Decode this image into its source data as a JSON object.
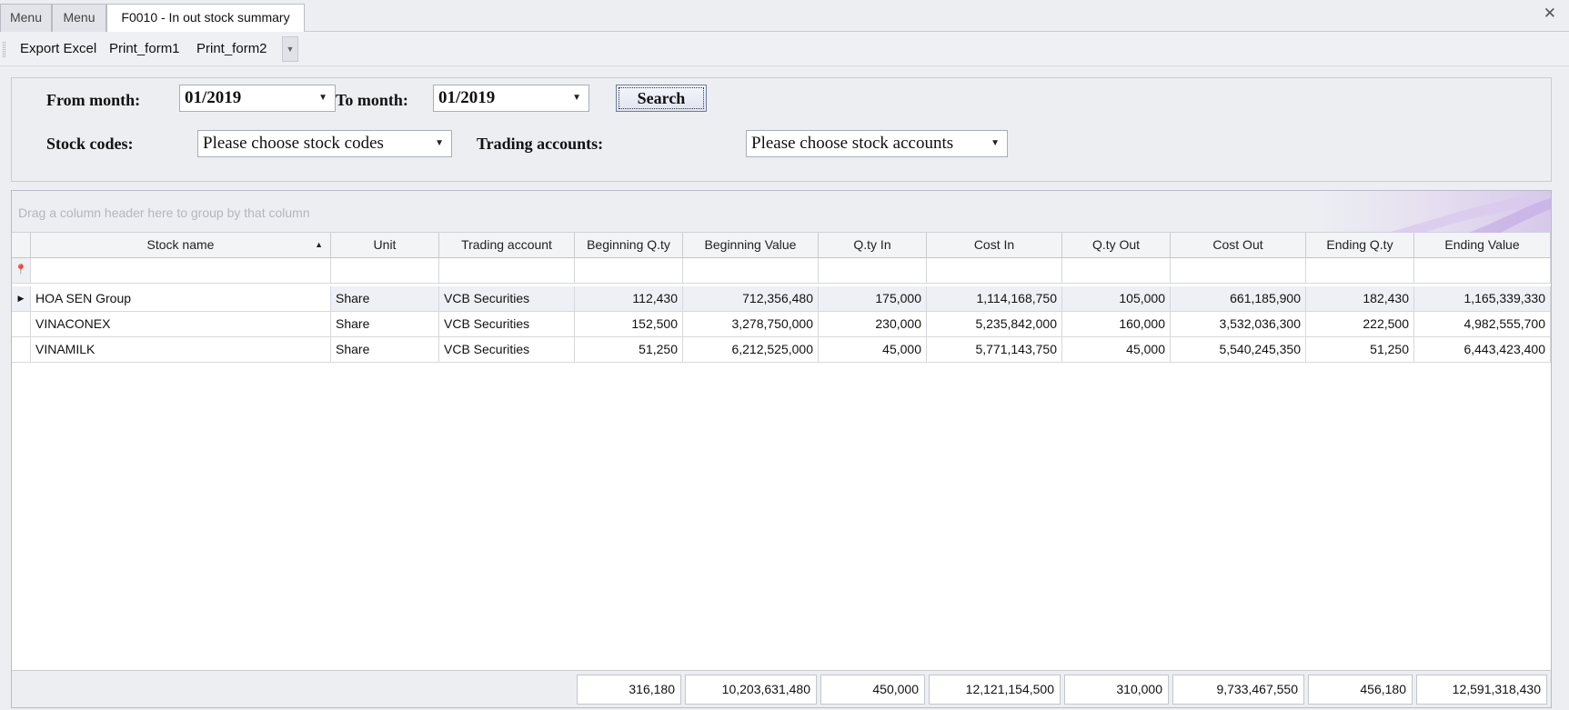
{
  "tabs": [
    {
      "label": "Menu"
    },
    {
      "label": "Menu"
    },
    {
      "label": "F0010 - In out stock summary"
    }
  ],
  "toolbar": {
    "export_excel": "Export Excel",
    "print_form1": "Print_form1",
    "print_form2": "Print_form2"
  },
  "filters": {
    "from_month_label": "From month:",
    "from_month_value": "01/2019",
    "to_month_label": "To month:",
    "to_month_value": "01/2019",
    "search_label": "Search",
    "stock_codes_label": "Stock codes:",
    "stock_codes_placeholder": "Please choose stock codes",
    "trading_accounts_label": "Trading accounts:",
    "trading_accounts_placeholder": "Please choose stock accounts"
  },
  "grid": {
    "group_hint": "Drag a column header here to group by that column",
    "columns": [
      "Stock name",
      "Unit",
      "Trading account",
      "Beginning Q.ty",
      "Beginning Value",
      "Q.ty In",
      "Cost In",
      "Q.ty Out",
      "Cost Out",
      "Ending Q.ty",
      "Ending Value"
    ],
    "rows": [
      [
        "HOA SEN Group",
        "Share",
        "VCB Securities",
        "112,430",
        "712,356,480",
        "175,000",
        "1,114,168,750",
        "105,000",
        "661,185,900",
        "182,430",
        "1,165,339,330"
      ],
      [
        "VINACONEX",
        "Share",
        "VCB Securities",
        "152,500",
        "3,278,750,000",
        "230,000",
        "5,235,842,000",
        "160,000",
        "3,532,036,300",
        "222,500",
        "4,982,555,700"
      ],
      [
        "VINAMILK",
        "Share",
        "VCB Securities",
        "51,250",
        "6,212,525,000",
        "45,000",
        "5,771,143,750",
        "45,000",
        "5,540,245,350",
        "51,250",
        "6,443,423,400"
      ]
    ],
    "totals": [
      "316,180",
      "10,203,631,480",
      "450,000",
      "12,121,154,500",
      "310,000",
      "9,733,467,550",
      "456,180",
      "12,591,318,430"
    ]
  },
  "colors": {
    "panel_bg": "#eceef1",
    "grid_border": "#b8bcc5",
    "search_border": "#6c7aa3"
  }
}
